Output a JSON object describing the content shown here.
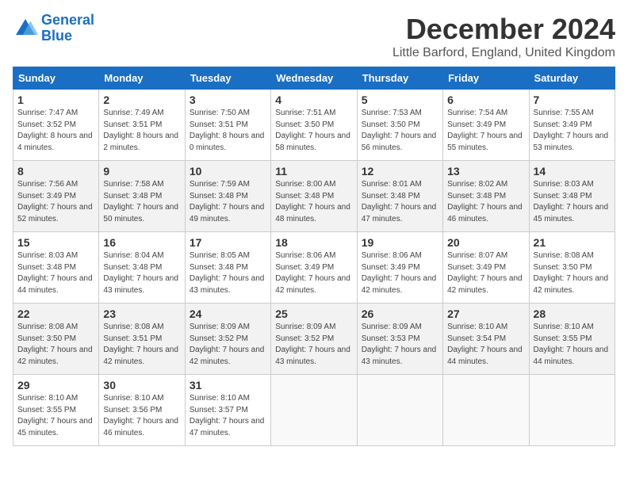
{
  "logo": {
    "text_general": "General",
    "text_blue": "Blue"
  },
  "title": "December 2024",
  "subtitle": "Little Barford, England, United Kingdom",
  "weekdays": [
    "Sunday",
    "Monday",
    "Tuesday",
    "Wednesday",
    "Thursday",
    "Friday",
    "Saturday"
  ],
  "weeks": [
    [
      {
        "day": "1",
        "sunrise": "Sunrise: 7:47 AM",
        "sunset": "Sunset: 3:52 PM",
        "daylight": "Daylight: 8 hours and 4 minutes."
      },
      {
        "day": "2",
        "sunrise": "Sunrise: 7:49 AM",
        "sunset": "Sunset: 3:51 PM",
        "daylight": "Daylight: 8 hours and 2 minutes."
      },
      {
        "day": "3",
        "sunrise": "Sunrise: 7:50 AM",
        "sunset": "Sunset: 3:51 PM",
        "daylight": "Daylight: 8 hours and 0 minutes."
      },
      {
        "day": "4",
        "sunrise": "Sunrise: 7:51 AM",
        "sunset": "Sunset: 3:50 PM",
        "daylight": "Daylight: 7 hours and 58 minutes."
      },
      {
        "day": "5",
        "sunrise": "Sunrise: 7:53 AM",
        "sunset": "Sunset: 3:50 PM",
        "daylight": "Daylight: 7 hours and 56 minutes."
      },
      {
        "day": "6",
        "sunrise": "Sunrise: 7:54 AM",
        "sunset": "Sunset: 3:49 PM",
        "daylight": "Daylight: 7 hours and 55 minutes."
      },
      {
        "day": "7",
        "sunrise": "Sunrise: 7:55 AM",
        "sunset": "Sunset: 3:49 PM",
        "daylight": "Daylight: 7 hours and 53 minutes."
      }
    ],
    [
      {
        "day": "8",
        "sunrise": "Sunrise: 7:56 AM",
        "sunset": "Sunset: 3:49 PM",
        "daylight": "Daylight: 7 hours and 52 minutes."
      },
      {
        "day": "9",
        "sunrise": "Sunrise: 7:58 AM",
        "sunset": "Sunset: 3:48 PM",
        "daylight": "Daylight: 7 hours and 50 minutes."
      },
      {
        "day": "10",
        "sunrise": "Sunrise: 7:59 AM",
        "sunset": "Sunset: 3:48 PM",
        "daylight": "Daylight: 7 hours and 49 minutes."
      },
      {
        "day": "11",
        "sunrise": "Sunrise: 8:00 AM",
        "sunset": "Sunset: 3:48 PM",
        "daylight": "Daylight: 7 hours and 48 minutes."
      },
      {
        "day": "12",
        "sunrise": "Sunrise: 8:01 AM",
        "sunset": "Sunset: 3:48 PM",
        "daylight": "Daylight: 7 hours and 47 minutes."
      },
      {
        "day": "13",
        "sunrise": "Sunrise: 8:02 AM",
        "sunset": "Sunset: 3:48 PM",
        "daylight": "Daylight: 7 hours and 46 minutes."
      },
      {
        "day": "14",
        "sunrise": "Sunrise: 8:03 AM",
        "sunset": "Sunset: 3:48 PM",
        "daylight": "Daylight: 7 hours and 45 minutes."
      }
    ],
    [
      {
        "day": "15",
        "sunrise": "Sunrise: 8:03 AM",
        "sunset": "Sunset: 3:48 PM",
        "daylight": "Daylight: 7 hours and 44 minutes."
      },
      {
        "day": "16",
        "sunrise": "Sunrise: 8:04 AM",
        "sunset": "Sunset: 3:48 PM",
        "daylight": "Daylight: 7 hours and 43 minutes."
      },
      {
        "day": "17",
        "sunrise": "Sunrise: 8:05 AM",
        "sunset": "Sunset: 3:48 PM",
        "daylight": "Daylight: 7 hours and 43 minutes."
      },
      {
        "day": "18",
        "sunrise": "Sunrise: 8:06 AM",
        "sunset": "Sunset: 3:49 PM",
        "daylight": "Daylight: 7 hours and 42 minutes."
      },
      {
        "day": "19",
        "sunrise": "Sunrise: 8:06 AM",
        "sunset": "Sunset: 3:49 PM",
        "daylight": "Daylight: 7 hours and 42 minutes."
      },
      {
        "day": "20",
        "sunrise": "Sunrise: 8:07 AM",
        "sunset": "Sunset: 3:49 PM",
        "daylight": "Daylight: 7 hours and 42 minutes."
      },
      {
        "day": "21",
        "sunrise": "Sunrise: 8:08 AM",
        "sunset": "Sunset: 3:50 PM",
        "daylight": "Daylight: 7 hours and 42 minutes."
      }
    ],
    [
      {
        "day": "22",
        "sunrise": "Sunrise: 8:08 AM",
        "sunset": "Sunset: 3:50 PM",
        "daylight": "Daylight: 7 hours and 42 minutes."
      },
      {
        "day": "23",
        "sunrise": "Sunrise: 8:08 AM",
        "sunset": "Sunset: 3:51 PM",
        "daylight": "Daylight: 7 hours and 42 minutes."
      },
      {
        "day": "24",
        "sunrise": "Sunrise: 8:09 AM",
        "sunset": "Sunset: 3:52 PM",
        "daylight": "Daylight: 7 hours and 42 minutes."
      },
      {
        "day": "25",
        "sunrise": "Sunrise: 8:09 AM",
        "sunset": "Sunset: 3:52 PM",
        "daylight": "Daylight: 7 hours and 43 minutes."
      },
      {
        "day": "26",
        "sunrise": "Sunrise: 8:09 AM",
        "sunset": "Sunset: 3:53 PM",
        "daylight": "Daylight: 7 hours and 43 minutes."
      },
      {
        "day": "27",
        "sunrise": "Sunrise: 8:10 AM",
        "sunset": "Sunset: 3:54 PM",
        "daylight": "Daylight: 7 hours and 44 minutes."
      },
      {
        "day": "28",
        "sunrise": "Sunrise: 8:10 AM",
        "sunset": "Sunset: 3:55 PM",
        "daylight": "Daylight: 7 hours and 44 minutes."
      }
    ],
    [
      {
        "day": "29",
        "sunrise": "Sunrise: 8:10 AM",
        "sunset": "Sunset: 3:55 PM",
        "daylight": "Daylight: 7 hours and 45 minutes."
      },
      {
        "day": "30",
        "sunrise": "Sunrise: 8:10 AM",
        "sunset": "Sunset: 3:56 PM",
        "daylight": "Daylight: 7 hours and 46 minutes."
      },
      {
        "day": "31",
        "sunrise": "Sunrise: 8:10 AM",
        "sunset": "Sunset: 3:57 PM",
        "daylight": "Daylight: 7 hours and 47 minutes."
      },
      null,
      null,
      null,
      null
    ]
  ]
}
